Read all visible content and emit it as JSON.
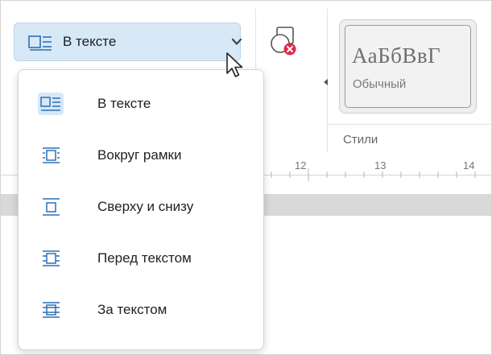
{
  "wrap_select": {
    "selected_label": "В тексте"
  },
  "wrap_menu": {
    "items": [
      {
        "label": "В тексте",
        "icon": "wrap-inline-icon",
        "selected": true
      },
      {
        "label": "Вокруг рамки",
        "icon": "wrap-square-icon",
        "selected": false
      },
      {
        "label": "Сверху и снизу",
        "icon": "wrap-top-bottom-icon",
        "selected": false
      },
      {
        "label": "Перед текстом",
        "icon": "wrap-in-front-icon",
        "selected": false
      },
      {
        "label": "За текстом",
        "icon": "wrap-behind-icon",
        "selected": false
      }
    ]
  },
  "styles": {
    "preview_text": "АаБбВвГ",
    "preview_name": "Обычный",
    "group_label": "Стили"
  },
  "ruler": {
    "numbers": [
      "12",
      "13",
      "14"
    ]
  },
  "colors": {
    "accent": "#2f6fb5",
    "selection_bg": "#d7e8f7",
    "close_badge": "#e0284a"
  }
}
